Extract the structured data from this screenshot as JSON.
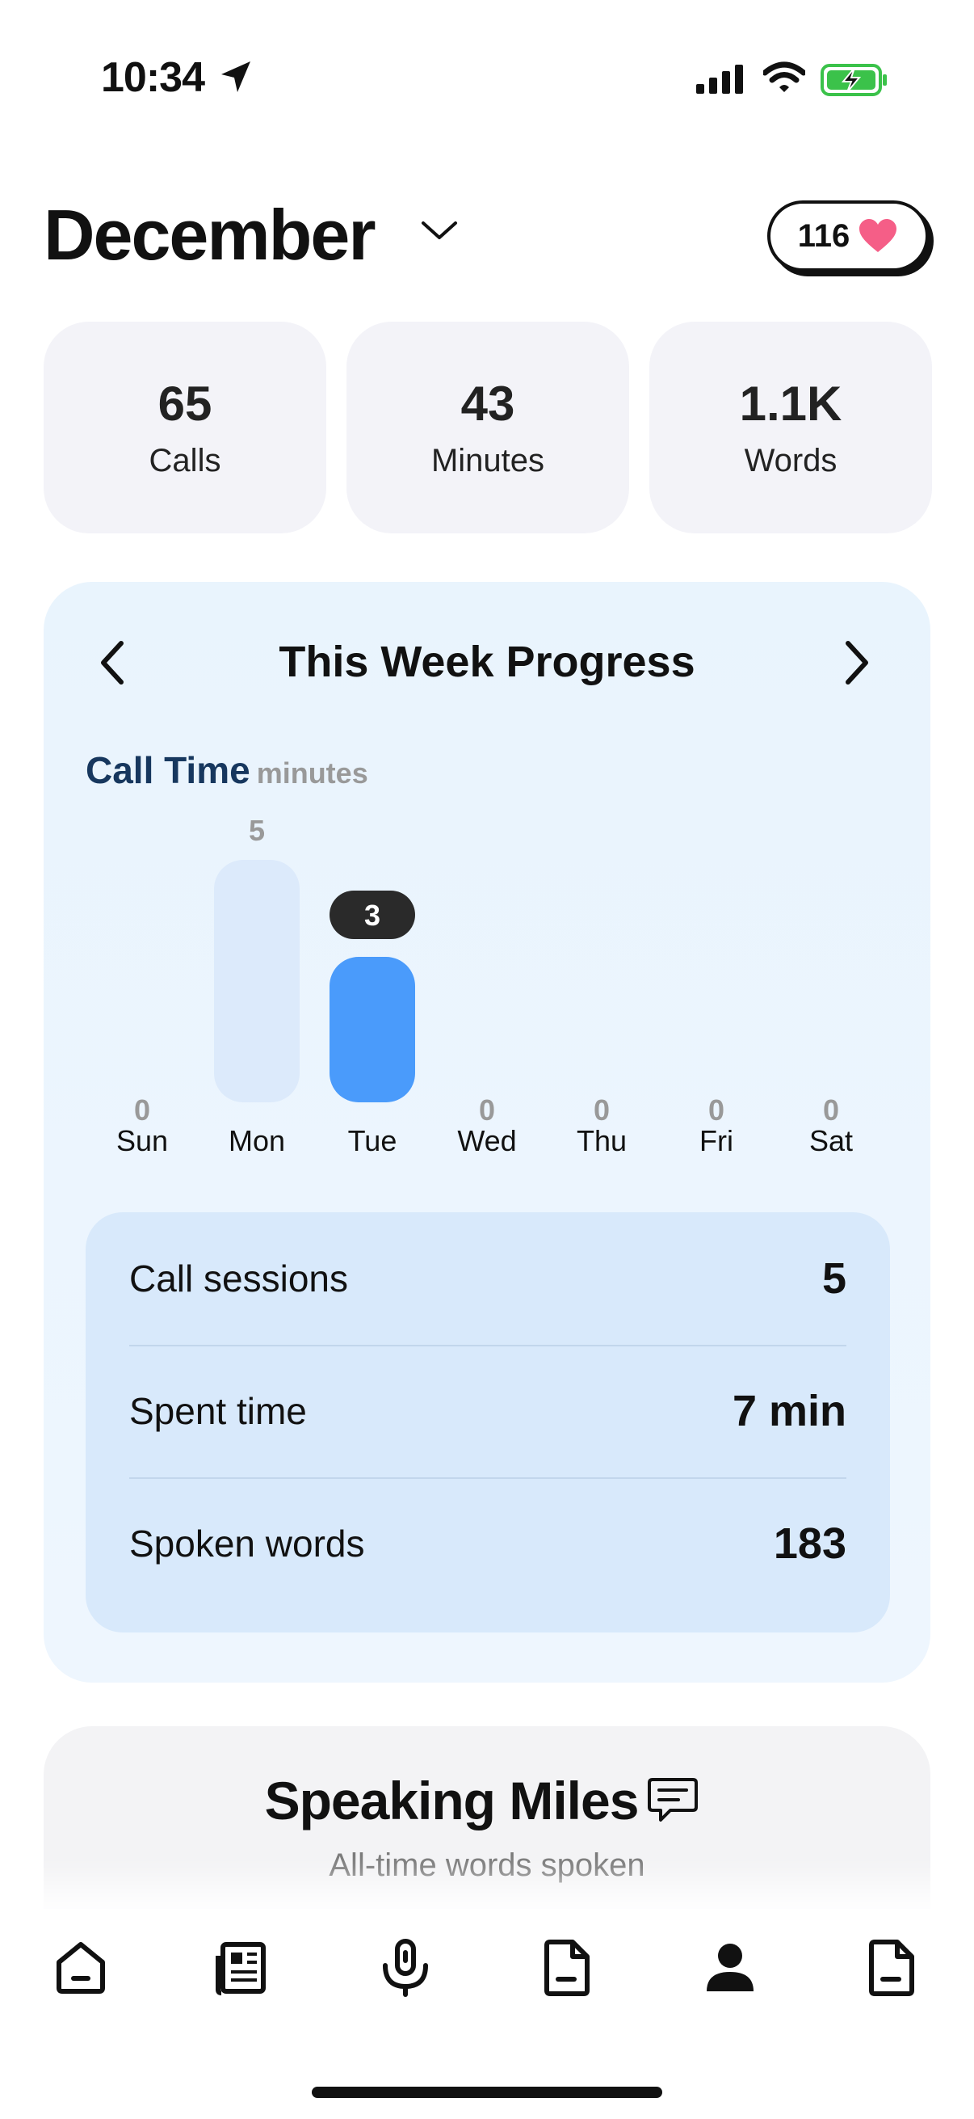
{
  "status_bar": {
    "time": "10:34"
  },
  "header": {
    "month": "December",
    "hearts_count": "116"
  },
  "stats": [
    {
      "value": "65",
      "label": "Calls"
    },
    {
      "value": "43",
      "label": "Minutes"
    },
    {
      "value": "1.1K",
      "label": "Words"
    }
  ],
  "week": {
    "title": "This Week Progress"
  },
  "chart_data": {
    "type": "bar",
    "title": "Call Time",
    "ylabel": "minutes",
    "categories": [
      "Sun",
      "Mon",
      "Tue",
      "Wed",
      "Thu",
      "Fri",
      "Sat"
    ],
    "values": [
      0,
      5,
      3,
      0,
      0,
      0,
      0
    ],
    "highlighted": "Tue",
    "colors": {
      "bar": "#dceafb",
      "highlight": "#4a9bfb",
      "badge": "#2a2a2a"
    }
  },
  "summary": [
    {
      "label": "Call sessions",
      "value": "5"
    },
    {
      "label": "Spent time",
      "value": "7 min"
    },
    {
      "label": "Spoken words",
      "value": "183"
    }
  ],
  "miles": {
    "title": "Speaking Miles",
    "subtitle": "All-time words spoken"
  },
  "tabs": [
    "home-icon",
    "news-icon",
    "microphone-icon",
    "document-icon",
    "profile-icon",
    "document-icon"
  ]
}
